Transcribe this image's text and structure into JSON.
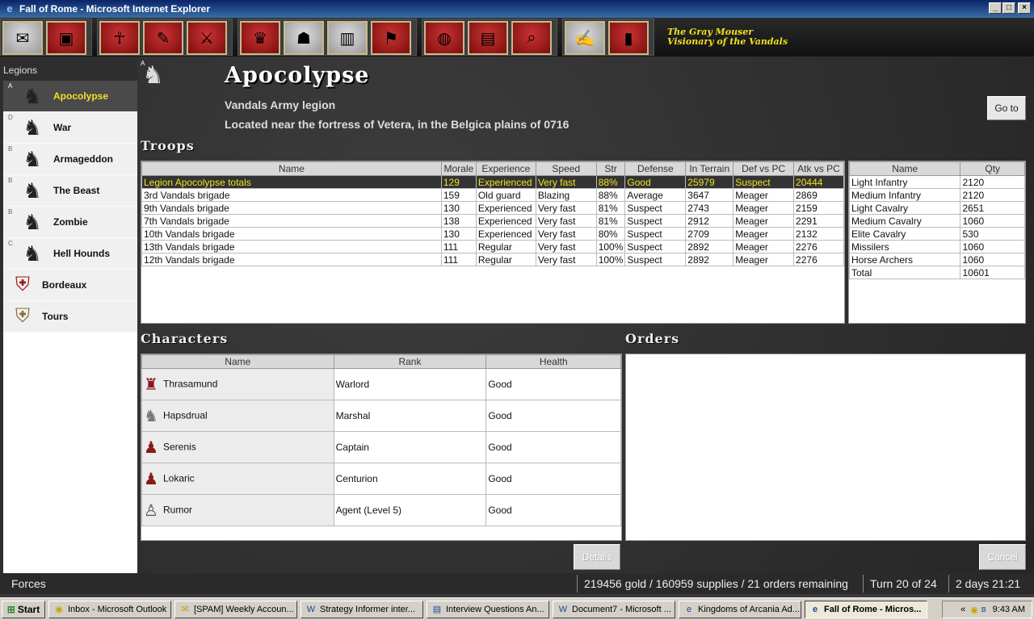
{
  "window": {
    "title": "Fall of Rome - Microsoft Internet Explorer",
    "minimize": "_",
    "maximize": "□",
    "close": "×"
  },
  "toolbar": {
    "groups": [
      [
        "scroll-money-icon",
        "treasure-chest-icon"
      ],
      [
        "wizard-icon",
        "decree-scroll-icon",
        "soldiers-icon"
      ],
      [
        "crown-icon",
        "senate-icon",
        "city-icon",
        "legion-icon"
      ],
      [
        "globe-icon",
        "map-icon",
        "magnifier-icon"
      ],
      [
        "writing-icon",
        "books-icon"
      ]
    ],
    "user_name": "The Gray Mouser",
    "user_rank": "Visionary of the Vandals"
  },
  "sidebar": {
    "heading": "Legions",
    "items": [
      {
        "badge": "A",
        "label": "Apocolypse",
        "kind": "legion",
        "selected": true
      },
      {
        "badge": "D",
        "label": "War",
        "kind": "legion"
      },
      {
        "badge": "B",
        "label": "Armageddon",
        "kind": "legion"
      },
      {
        "badge": "B",
        "label": "The Beast",
        "kind": "legion"
      },
      {
        "badge": "B",
        "label": "Zombie",
        "kind": "legion"
      },
      {
        "badge": "C",
        "label": "Hell Hounds",
        "kind": "legion"
      },
      {
        "label": "Bordeaux",
        "kind": "city"
      },
      {
        "label": "Tours",
        "kind": "city"
      }
    ]
  },
  "legion": {
    "badge": "A",
    "name": "Apocolypse",
    "subtitle": "Vandals Army legion",
    "location": "Located near the fortress of Vetera, in the Belgica plains of 0716",
    "goto_label": "Go to"
  },
  "troops": {
    "title": "Troops",
    "columns": [
      "Name",
      "Morale",
      "Experience",
      "Speed",
      "Str",
      "Defense",
      "In Terrain",
      "Def vs PC",
      "Atk vs PC"
    ],
    "rows": [
      [
        "Legion Apocolypse totals",
        "129",
        "Experienced",
        "Very fast",
        "88%",
        "Good",
        "25979",
        "Suspect",
        "20444"
      ],
      [
        "3rd Vandals brigade",
        "159",
        "Old guard",
        "Blazing",
        "88%",
        "Average",
        "3647",
        "Meager",
        "2869"
      ],
      [
        "9th Vandals brigade",
        "130",
        "Experienced",
        "Very fast",
        "81%",
        "Suspect",
        "2743",
        "Meager",
        "2159"
      ],
      [
        "7th Vandals brigade",
        "138",
        "Experienced",
        "Very fast",
        "81%",
        "Suspect",
        "2912",
        "Meager",
        "2291"
      ],
      [
        "10th Vandals brigade",
        "130",
        "Experienced",
        "Very fast",
        "80%",
        "Suspect",
        "2709",
        "Meager",
        "2132"
      ],
      [
        "13th Vandals brigade",
        "111",
        "Regular",
        "Very fast",
        "100%",
        "Suspect",
        "2892",
        "Meager",
        "2276"
      ],
      [
        "12th Vandals brigade",
        "111",
        "Regular",
        "Very fast",
        "100%",
        "Suspect",
        "2892",
        "Meager",
        "2276"
      ]
    ]
  },
  "unit_types": {
    "columns": [
      "Name",
      "Qty"
    ],
    "rows": [
      [
        "Light Infantry",
        "2120"
      ],
      [
        "Medium Infantry",
        "2120"
      ],
      [
        "Light Cavalry",
        "2651"
      ],
      [
        "Medium Cavalry",
        "1060"
      ],
      [
        "Elite Cavalry",
        "530"
      ],
      [
        "Missilers",
        "1060"
      ],
      [
        "Horse Archers",
        "1060"
      ],
      [
        "Total",
        "10601"
      ]
    ]
  },
  "characters": {
    "title": "Characters",
    "columns": [
      "Name",
      "Rank",
      "Health"
    ],
    "rows": [
      [
        "Thrasamund",
        "Warlord",
        "Good"
      ],
      [
        "Hapsdrual",
        "Marshal",
        "Good"
      ],
      [
        "Serenis",
        "Captain",
        "Good"
      ],
      [
        "Lokaric",
        "Centurion",
        "Good"
      ],
      [
        "Rumor",
        "Agent (Level 5)",
        "Good"
      ]
    ],
    "details_label": "Details"
  },
  "orders": {
    "title": "Orders",
    "cancel_label": "Cancel"
  },
  "status": {
    "left": "Forces",
    "resources": "219456 gold / 160959 supplies / 21 orders remaining",
    "turn": "Turn 20 of 24",
    "time_left": "2 days 21:21"
  },
  "taskbar": {
    "start": "Start",
    "tasks": [
      {
        "icon": "outlook-icon",
        "label": "Inbox - Microsoft Outlook"
      },
      {
        "icon": "mail-icon",
        "label": "[SPAM] Weekly Accoun..."
      },
      {
        "icon": "word-icon",
        "label": "Strategy Informer inter..."
      },
      {
        "icon": "document-icon",
        "label": "Interview Questions An..."
      },
      {
        "icon": "word-icon",
        "label": "Document7 - Microsoft ..."
      },
      {
        "icon": "ie-icon",
        "label": "Kingdoms of Arcania Ad..."
      },
      {
        "icon": "ie-icon",
        "label": "Fall of Rome - Micros...",
        "active": true
      }
    ],
    "clock": "9:43 AM"
  }
}
